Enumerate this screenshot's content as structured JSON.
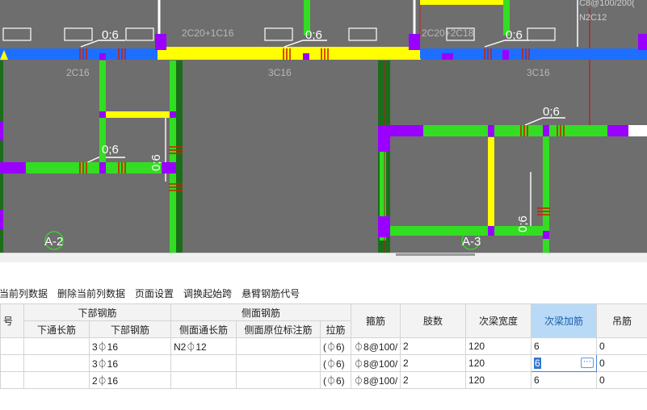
{
  "canvas": {
    "beam_labels": [
      "2C20+1C16",
      "2C20+2C18",
      "2C16",
      "3C16",
      "3C16"
    ],
    "side_labels": [
      "0;6",
      "0;6",
      "0;6",
      "0;6",
      "0;6",
      "0;6",
      "0;6",
      "0;6"
    ],
    "top_right_note": [
      "C8@100/200(",
      "N2C12"
    ],
    "axis_markers": [
      "A-2",
      "A-3"
    ]
  },
  "toolbar": {
    "items": [
      "入当前列数据",
      "删除当前列数据",
      "页面设置",
      "调换起始跨",
      "悬臂钢筋代号"
    ]
  },
  "table": {
    "group_headers": {
      "col0": "号",
      "bottom_rebar": "下部钢筋",
      "side_rebar": "侧面钢筋",
      "stirrup": "箍筋",
      "legs": "肢数",
      "sec_width": "次梁宽度",
      "sec_add": "次梁加筋",
      "hanger": "吊筋"
    },
    "sub_headers": {
      "bottom_through": "下通长筋",
      "bottom": "下部钢筋",
      "side_through": "侧面通长筋",
      "side_orig": "侧面原位标注筋",
      "tie": "拉筋"
    },
    "rows": [
      {
        "no": "",
        "bottom_through": "",
        "bottom": "3⏀16",
        "side_through": "N2⏀12",
        "side_orig": "",
        "tie": "(⏀6)",
        "stirrup": "⏀8@100/",
        "legs": "2",
        "sec_width": "120",
        "sec_add": "6",
        "hanger": "0"
      },
      {
        "no": "",
        "bottom_through": "",
        "bottom": "3⏀16",
        "side_through": "",
        "side_orig": "",
        "tie": "(⏀6)",
        "stirrup": "⏀8@100/",
        "legs": "2",
        "sec_width": "120",
        "sec_add": "6",
        "hanger": "0"
      },
      {
        "no": "",
        "bottom_through": "",
        "bottom": "2⏀16",
        "side_through": "",
        "side_orig": "",
        "tie": "(⏀6)",
        "stirrup": "⏀8@100/",
        "legs": "2",
        "sec_width": "120",
        "sec_add": "6",
        "hanger": "0"
      }
    ],
    "edit_button": "⋯"
  },
  "colors": {
    "canvas_bg": "#6e6e6e",
    "beam_green": "#33dd22",
    "beam_yellow": "#ffff00",
    "beam_blue": "#1e6fff",
    "support_purple": "#9900ff",
    "rebar_mark": "#cc2200",
    "header_selected": "#b9daf7"
  }
}
